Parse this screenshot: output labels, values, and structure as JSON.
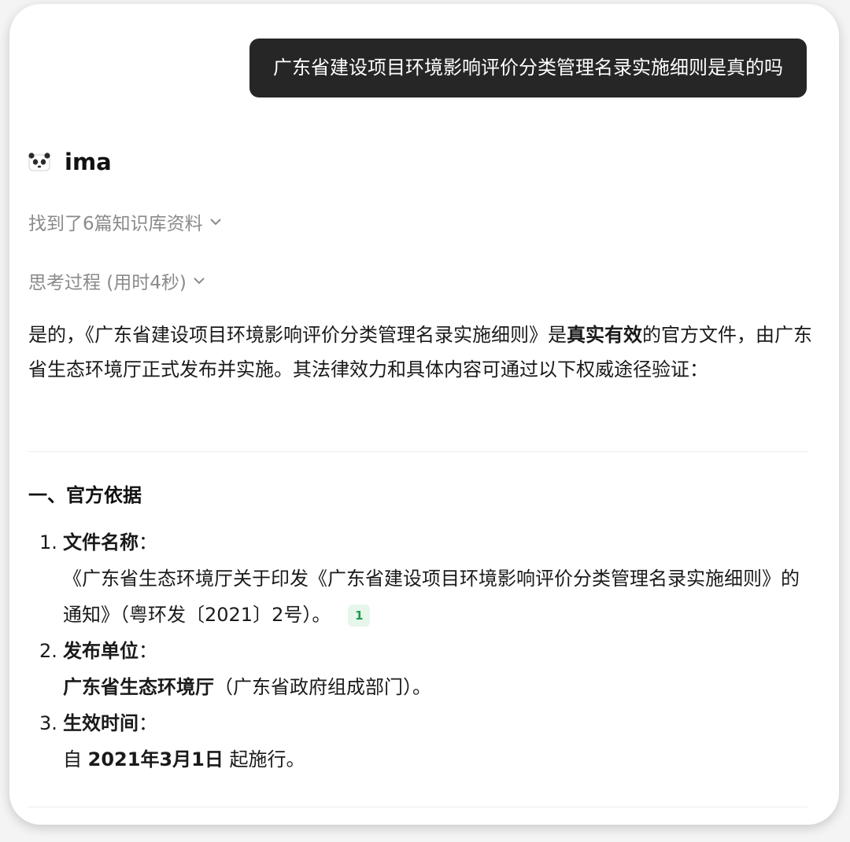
{
  "user_message": "广东省建设项目环境影响评价分类管理名录实施细则是真的吗",
  "assistant": {
    "name": "ima",
    "knowledge_toggle": "找到了6篇知识库资料",
    "thinking_toggle": "思考过程 (用时4秒)"
  },
  "answer": {
    "intro_prefix": "是的，《广东省建设项目环境影响评价分类管理名录实施细则》是",
    "intro_bold": "真实有效",
    "intro_suffix": "的官方文件，由广东省生态环境厅正式发布并实施。其法律效力和具体内容可通过以下权威途径验证：",
    "section_title": "一、官方依据",
    "items": [
      {
        "num": "1.",
        "label": "文件名称",
        "colon": "：",
        "body": "《广东省生态环境厅关于印发《广东省建设项目环境影响评价分类管理名录实施细则》的通知》（粤环发〔2021〕2号）。",
        "citation": "1"
      },
      {
        "num": "2.",
        "label": "发布单位",
        "colon": "：",
        "body_bold": "广东省生态环境厅",
        "body_rest": "（广东省政府组成部门）。"
      },
      {
        "num": "3.",
        "label": "生效时间",
        "colon": "：",
        "body_pre": "自 ",
        "body_bold": "2021年3月1日",
        "body_post": " 起施行。"
      }
    ]
  }
}
